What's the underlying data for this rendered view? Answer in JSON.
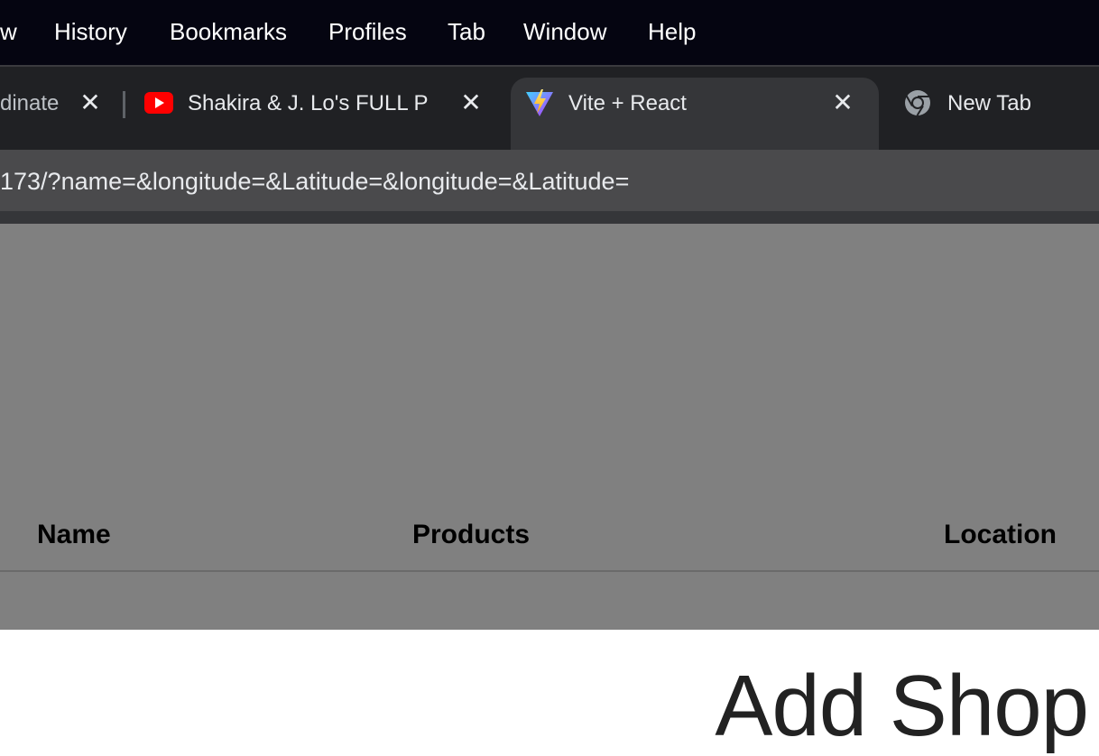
{
  "menubar": {
    "items": [
      "w",
      "History",
      "Bookmarks",
      "Profiles",
      "Tab",
      "Window",
      "Help"
    ]
  },
  "tabs": [
    {
      "title": "dinate",
      "icon": "none"
    },
    {
      "title": "Shakira & J. Lo's FULL P",
      "icon": "youtube-icon"
    },
    {
      "title": "Vite + React",
      "icon": "vite-icon",
      "active": true
    },
    {
      "title": "New Tab",
      "icon": "chrome-icon"
    }
  ],
  "tab_close_glyph": "✕",
  "address_bar": {
    "url": "173/?name=&longitude=&Latitude=&longitude=&Latitude="
  },
  "table": {
    "headers": [
      "Name",
      "Products",
      "Location"
    ]
  },
  "page_heading": "Add Shop",
  "colors": {
    "menubar_bg": "#050511",
    "tabstrip_bg": "#202124",
    "active_tab_bg": "#353639",
    "overlay_gray": "#808080",
    "youtube_red": "#ff0000"
  }
}
